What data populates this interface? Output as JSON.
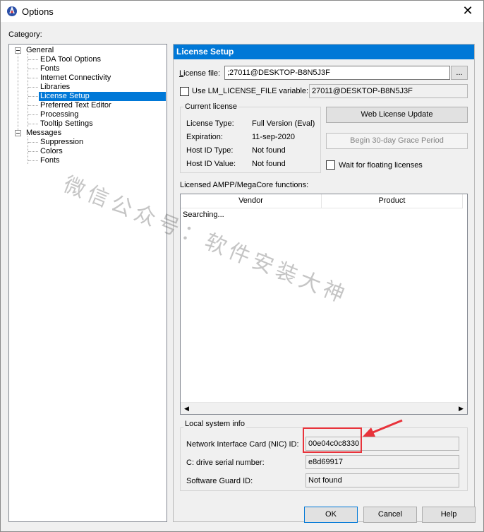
{
  "window": {
    "title": "Options"
  },
  "category_label": "Category:",
  "tree": {
    "general": "General",
    "general_children": [
      "EDA Tool Options",
      "Fonts",
      "Internet Connectivity",
      "Libraries",
      "License Setup",
      "Preferred Text Editor",
      "Processing",
      "Tooltip Settings"
    ],
    "messages": "Messages",
    "messages_children": [
      "Suppression",
      "Colors",
      "Fonts"
    ],
    "selected": "License Setup"
  },
  "panel": {
    "header": "License Setup",
    "license_file_label": "License file:",
    "license_file_value": ";27011@DESKTOP-B8N5J3F",
    "browse_label": "...",
    "use_lm_label": "Use LM_LICENSE_FILE variable:",
    "lm_value": "27011@DESKTOP-B8N5J3F",
    "current_license": {
      "title": "Current license",
      "rows": [
        {
          "label": "License Type:",
          "value": "Full Version (Eval)"
        },
        {
          "label": "Expiration:",
          "value": "11-sep-2020"
        },
        {
          "label": "Host ID Type:",
          "value": "Not found"
        },
        {
          "label": "Host ID Value:",
          "value": "Not found"
        }
      ]
    },
    "web_license_update": "Web License Update",
    "grace_period": "Begin 30-day Grace Period",
    "wait_floating": "Wait for floating licenses",
    "functions_label": "Licensed AMPP/MegaCore functions:",
    "columns": [
      "Vendor",
      "Product"
    ],
    "list_status": "Searching...",
    "local_system": {
      "title": "Local system info",
      "nic_label": "Network Interface Card (NIC) ID:",
      "nic_value": "00e04c0c8330",
      "drive_label": "C: drive serial number:",
      "drive_value": "e8d69917",
      "guard_label": "Software Guard ID:",
      "guard_value": "Not found"
    }
  },
  "buttons": {
    "ok": "OK",
    "cancel": "Cancel",
    "help": "Help"
  },
  "watermark": "微信公众号：软件安装大神",
  "colors": {
    "accent": "#0078d7",
    "highlight": "#e8333b"
  }
}
